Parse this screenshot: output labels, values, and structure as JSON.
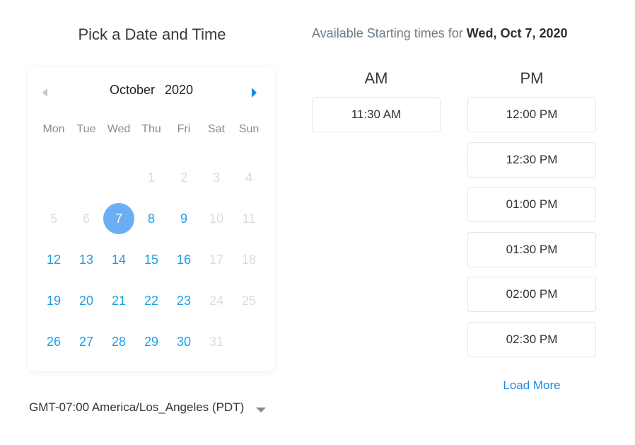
{
  "page_title": "Pick a Date and Time",
  "calendar": {
    "month": "October",
    "year": "2020",
    "prev_icon": "chevron-left-icon",
    "next_icon": "chevron-right-icon",
    "weekdays": [
      "Mon",
      "Tue",
      "Wed",
      "Thu",
      "Fri",
      "Sat",
      "Sun"
    ],
    "leading_blanks": 3,
    "days": [
      {
        "n": "1",
        "state": "disabled"
      },
      {
        "n": "2",
        "state": "disabled"
      },
      {
        "n": "3",
        "state": "disabled"
      },
      {
        "n": "4",
        "state": "disabled"
      },
      {
        "n": "5",
        "state": "disabled"
      },
      {
        "n": "6",
        "state": "disabled"
      },
      {
        "n": "7",
        "state": "selected"
      },
      {
        "n": "8",
        "state": "available"
      },
      {
        "n": "9",
        "state": "available"
      },
      {
        "n": "10",
        "state": "disabled"
      },
      {
        "n": "11",
        "state": "disabled"
      },
      {
        "n": "12",
        "state": "available"
      },
      {
        "n": "13",
        "state": "available"
      },
      {
        "n": "14",
        "state": "available"
      },
      {
        "n": "15",
        "state": "available"
      },
      {
        "n": "16",
        "state": "available"
      },
      {
        "n": "17",
        "state": "disabled"
      },
      {
        "n": "18",
        "state": "disabled"
      },
      {
        "n": "19",
        "state": "available"
      },
      {
        "n": "20",
        "state": "available"
      },
      {
        "n": "21",
        "state": "available"
      },
      {
        "n": "22",
        "state": "available"
      },
      {
        "n": "23",
        "state": "available"
      },
      {
        "n": "24",
        "state": "disabled"
      },
      {
        "n": "25",
        "state": "disabled"
      },
      {
        "n": "26",
        "state": "available"
      },
      {
        "n": "27",
        "state": "available"
      },
      {
        "n": "28",
        "state": "available"
      },
      {
        "n": "29",
        "state": "available"
      },
      {
        "n": "30",
        "state": "available"
      },
      {
        "n": "31",
        "state": "disabled"
      }
    ]
  },
  "timezone": {
    "label": "GMT-07:00 America/Los_Angeles (PDT)",
    "icon": "caret-down-icon"
  },
  "availability": {
    "title_prefix": "Available Starting times for ",
    "selected_date": "Wed, Oct 7, 2020",
    "am_label": "AM",
    "pm_label": "PM",
    "am_slots": [
      "11:30 AM"
    ],
    "pm_slots": [
      "12:00 PM",
      "12:30 PM",
      "01:00 PM",
      "01:30 PM",
      "02:00 PM",
      "02:30 PM"
    ],
    "load_more": "Load More"
  },
  "colors": {
    "accent": "#1e88e5",
    "available_day": "#1a9fe8",
    "selected_day_bg": "#6aaef5",
    "disabled_day": "#dcdcdc"
  }
}
